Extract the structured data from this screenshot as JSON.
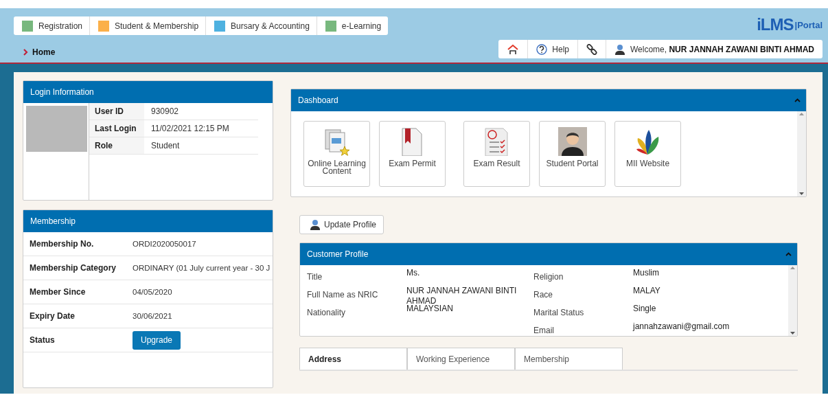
{
  "modules": [
    {
      "label": "Registration",
      "color": "#78b87e"
    },
    {
      "label": "Student & Membership",
      "color": "#fbb04a"
    },
    {
      "label": "Bursary & Accounting",
      "color": "#4eb1e0"
    },
    {
      "label": "e-Learning",
      "color": "#78b87e"
    }
  ],
  "breadcrumb": "Home",
  "logo": {
    "brand": "iLMS",
    "suffix": "|Portal"
  },
  "toolbar": [
    {
      "kind": "home"
    },
    {
      "kind": "help",
      "label": "Help"
    },
    {
      "kind": "links"
    },
    {
      "kind": "user",
      "label": "Welcome,",
      "name": "NUR JANNAH ZAWANI BINTI AHMAD"
    }
  ],
  "login_information": {
    "title": "Login Information",
    "fields": [
      {
        "label": "User ID",
        "value": "930902"
      },
      {
        "label": "Last Login",
        "value": "11/02/2021 12:15 PM"
      },
      {
        "label": "Role",
        "value": "Student"
      }
    ]
  },
  "membership": {
    "title": "Membership",
    "fields": [
      {
        "label": "Membership No.",
        "kind": "text",
        "value": "ORDI2020050017"
      },
      {
        "label": "Membership Category",
        "kind": "text",
        "value": "ORDINARY (01 July current year - 30 J"
      },
      {
        "label": "Member Since",
        "kind": "text",
        "value": "04/05/2020"
      },
      {
        "label": "Expiry Date",
        "kind": "text",
        "value": "30/06/2021"
      },
      {
        "label": "Status",
        "kind": "button",
        "value": "Upgrade"
      }
    ]
  },
  "dashboard": {
    "title": "Dashboard",
    "expanded": true,
    "tiles": [
      {
        "kind": "docs",
        "label": "Online Learning Content"
      },
      {
        "kind": "permit",
        "label": "Exam Permit"
      },
      {
        "kind": "result",
        "label": "Exam Result"
      },
      {
        "kind": "person",
        "label": "Student Portal"
      },
      {
        "kind": "leaf",
        "label": "MII Website"
      }
    ]
  },
  "update_profile": "Update Profile",
  "customer_profile": {
    "title": "Customer Profile",
    "expanded": true,
    "rows": [
      {
        "left": {
          "label": "Title",
          "value": "Ms."
        },
        "right": {
          "label": "Religion",
          "value": "Muslim"
        }
      },
      {
        "left": {
          "label": "Full Name as NRIC",
          "value": "NUR JANNAH ZAWANI BINTI AHMAD"
        },
        "right": {
          "label": "Race",
          "value": "MALAY"
        }
      },
      {
        "left": {
          "label": "Nationality",
          "value": "MALAYSIAN"
        },
        "right": {
          "label": "Marital Status",
          "value": "Single"
        }
      },
      {
        "right": {
          "label": "Email",
          "value": "jannahzawani@gmail.com"
        }
      }
    ]
  },
  "tabs": [
    {
      "label": "Address",
      "selected": true
    },
    {
      "label": "Working Experience",
      "selected": false
    },
    {
      "label": "Membership",
      "selected": false
    }
  ]
}
